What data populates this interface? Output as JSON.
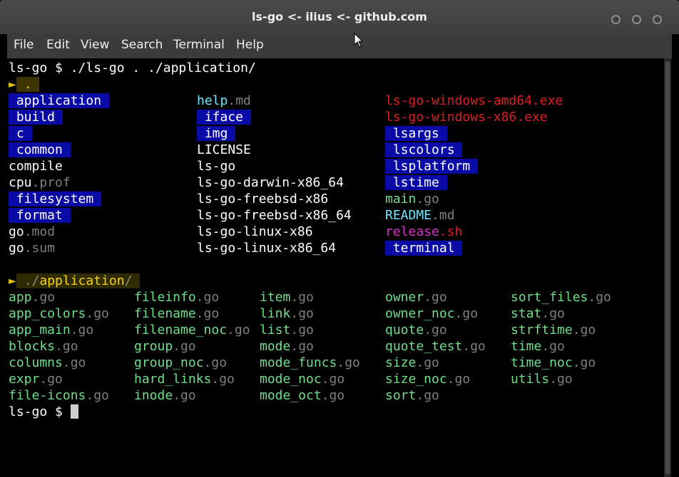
{
  "window": {
    "title": "ls-go <- ilius <- github.com"
  },
  "menu": [
    "File",
    "Edit",
    "View",
    "Search",
    "Terminal",
    "Help"
  ],
  "terminal": {
    "prompt": "ls-go $ ",
    "command": "./ls-go . ./application/",
    "section1": {
      "arrow": "►",
      "path": "."
    },
    "col1": [
      {
        "name": "application",
        "kind": "dir"
      },
      {
        "name": "build",
        "kind": "dir"
      },
      {
        "name": "c",
        "kind": "dir"
      },
      {
        "name": "common",
        "kind": "dir"
      },
      {
        "name": "compile",
        "kind": "file"
      },
      {
        "name": "cpu",
        "ext": ".prof",
        "kind": "file"
      },
      {
        "name": "filesystem",
        "kind": "dir"
      },
      {
        "name": "format",
        "kind": "dir"
      },
      {
        "name": "go",
        "ext": ".mod",
        "kind": "file"
      },
      {
        "name": "go",
        "ext": ".sum",
        "kind": "file"
      }
    ],
    "col2": [
      {
        "name": "help",
        "ext": ".md",
        "kind": "md"
      },
      {
        "name": "iface",
        "kind": "dir"
      },
      {
        "name": "img",
        "kind": "dir"
      },
      {
        "name": "LICENSE",
        "kind": "file"
      },
      {
        "name": "ls-go",
        "kind": "file"
      },
      {
        "name": "ls-go-darwin-x86_64",
        "kind": "file"
      },
      {
        "name": "ls-go-freebsd-x86",
        "kind": "file"
      },
      {
        "name": "ls-go-freebsd-x86_64",
        "kind": "file"
      },
      {
        "name": "ls-go-linux-x86",
        "kind": "file"
      },
      {
        "name": "ls-go-linux-x86_64",
        "kind": "file"
      }
    ],
    "col3": [
      {
        "name": "ls-go-windows-amd64.exe",
        "kind": "exe"
      },
      {
        "name": "ls-go-windows-x86.exe",
        "kind": "exe"
      },
      {
        "name": "lsargs",
        "kind": "dir"
      },
      {
        "name": "lscolors",
        "kind": "dir"
      },
      {
        "name": "lsplatform",
        "kind": "dir"
      },
      {
        "name": "lstime",
        "kind": "dir"
      },
      {
        "name": "main",
        "ext": ".go",
        "kind": "go"
      },
      {
        "name": "README",
        "ext": ".md",
        "kind": "md"
      },
      {
        "name": "release",
        "ext": ".sh",
        "kind": "sh"
      },
      {
        "name": "terminal",
        "kind": "dir"
      }
    ],
    "section2": {
      "arrow": "►",
      "prefix": "./",
      "name": "application",
      "suffix": "/"
    },
    "app_files": [
      [
        "app",
        "fileinfo",
        "item",
        "owner",
        "sort_files"
      ],
      [
        "app_colors",
        "filename",
        "link",
        "owner_noc",
        "stat"
      ],
      [
        "app_main",
        "filename_noc",
        "list",
        "quote",
        "strftime"
      ],
      [
        "blocks",
        "group",
        "mode",
        "quote_test",
        "time"
      ],
      [
        "columns",
        "group_noc",
        "mode_funcs",
        "size",
        "time_noc"
      ],
      [
        "expr",
        "hard_links",
        "mode_noc",
        "size_noc",
        "utils"
      ],
      [
        "file-icons",
        "inode",
        "mode_oct",
        "sort",
        ""
      ]
    ],
    "go_ext": ".go",
    "final_prompt": "ls-go $ "
  }
}
